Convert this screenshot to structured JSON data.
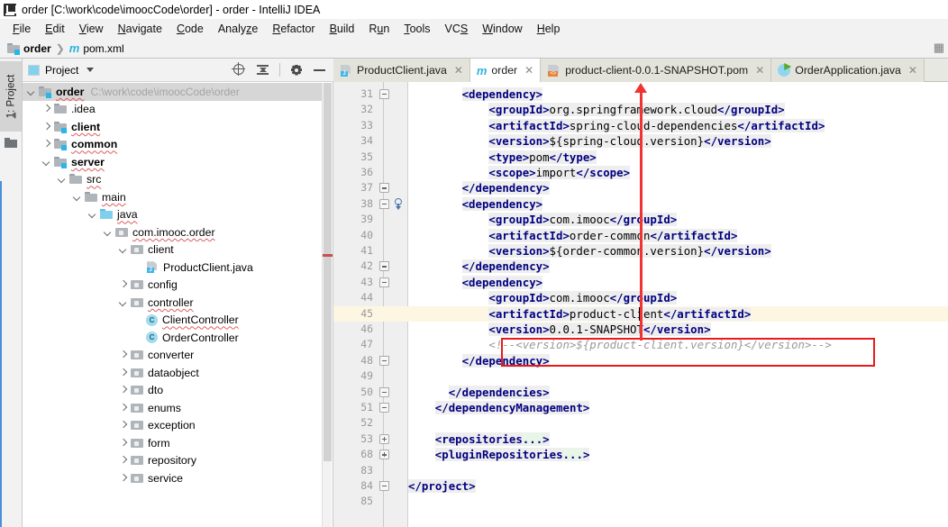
{
  "window": {
    "title": "order [C:\\work\\code\\imoocCode\\order] - order - IntelliJ IDEA",
    "logo_icon": "intellij-idea-logo"
  },
  "menubar": {
    "items": [
      {
        "label": "File",
        "mnemonic": "F"
      },
      {
        "label": "Edit",
        "mnemonic": "E"
      },
      {
        "label": "View",
        "mnemonic": "V"
      },
      {
        "label": "Navigate",
        "mnemonic": "N"
      },
      {
        "label": "Code",
        "mnemonic": "C"
      },
      {
        "label": "Analyze",
        "mnemonic": "z"
      },
      {
        "label": "Refactor",
        "mnemonic": "R"
      },
      {
        "label": "Build",
        "mnemonic": "B"
      },
      {
        "label": "Run",
        "mnemonic": "u"
      },
      {
        "label": "Tools",
        "mnemonic": "T"
      },
      {
        "label": "VCS",
        "mnemonic": "S"
      },
      {
        "label": "Window",
        "mnemonic": "W"
      },
      {
        "label": "Help",
        "mnemonic": "H"
      }
    ]
  },
  "navbar": {
    "crumbs": [
      {
        "label": "order",
        "icon": "module-folder-icon"
      },
      {
        "label": "pom.xml",
        "icon": "maven-m-icon"
      }
    ]
  },
  "left_strip": {
    "tab_label": "1: Project",
    "tab_mnemonic": "1",
    "folder_icon": "folder-icon"
  },
  "project_panel": {
    "title": "Project",
    "tools": [
      {
        "name": "locate-icon",
        "label": "Select Opened File"
      },
      {
        "name": "collapse-all-icon",
        "label": "Collapse All"
      },
      {
        "name": "gear-icon",
        "label": "Settings"
      },
      {
        "name": "minimize-icon",
        "label": "Hide"
      }
    ],
    "tree": [
      {
        "label": "order",
        "path": "C:\\work\\code\\imoocCode\\order",
        "indent": 0,
        "arrow": "down",
        "icon": "module-folder-icon",
        "bold": true,
        "selected": true,
        "squiggle": true
      },
      {
        "label": ".idea",
        "indent": 1,
        "arrow": "right",
        "icon": "folder-icon",
        "bold": false
      },
      {
        "label": "client",
        "indent": 1,
        "arrow": "right",
        "icon": "module-folder-icon",
        "bold": true,
        "squiggle": true
      },
      {
        "label": "common",
        "indent": 1,
        "arrow": "right",
        "icon": "module-folder-icon",
        "bold": true,
        "squiggle": true
      },
      {
        "label": "server",
        "indent": 1,
        "arrow": "down",
        "icon": "module-folder-icon",
        "bold": true,
        "squiggle": true
      },
      {
        "label": "src",
        "indent": 2,
        "arrow": "down",
        "icon": "folder-icon",
        "bold": false,
        "squiggle": true
      },
      {
        "label": "main",
        "indent": 3,
        "arrow": "down",
        "icon": "folder-icon",
        "bold": false,
        "squiggle": true
      },
      {
        "label": "java",
        "indent": 4,
        "arrow": "down",
        "icon": "source-folder-icon",
        "bold": false,
        "squiggle": true
      },
      {
        "label": "com.imooc.order",
        "indent": 5,
        "arrow": "down",
        "icon": "package-icon",
        "bold": false,
        "squiggle": true
      },
      {
        "label": "client",
        "indent": 6,
        "arrow": "down",
        "icon": "package-icon",
        "bold": false
      },
      {
        "label": "ProductClient.java",
        "indent": 7,
        "arrow": "none",
        "icon": "java-file-icon",
        "bold": false
      },
      {
        "label": "config",
        "indent": 6,
        "arrow": "right",
        "icon": "package-icon",
        "bold": false
      },
      {
        "label": "controller",
        "indent": 6,
        "arrow": "down",
        "icon": "package-icon",
        "bold": false,
        "squiggle": true
      },
      {
        "label": "ClientController",
        "indent": 7,
        "arrow": "none",
        "icon": "java-class-icon",
        "bold": false,
        "squiggle": true
      },
      {
        "label": "OrderController",
        "indent": 7,
        "arrow": "none",
        "icon": "java-class-icon",
        "bold": false
      },
      {
        "label": "converter",
        "indent": 6,
        "arrow": "right",
        "icon": "package-icon",
        "bold": false
      },
      {
        "label": "dataobject",
        "indent": 6,
        "arrow": "right",
        "icon": "package-icon",
        "bold": false
      },
      {
        "label": "dto",
        "indent": 6,
        "arrow": "right",
        "icon": "package-icon",
        "bold": false
      },
      {
        "label": "enums",
        "indent": 6,
        "arrow": "right",
        "icon": "package-icon",
        "bold": false
      },
      {
        "label": "exception",
        "indent": 6,
        "arrow": "right",
        "icon": "package-icon",
        "bold": false
      },
      {
        "label": "form",
        "indent": 6,
        "arrow": "right",
        "icon": "package-icon",
        "bold": false
      },
      {
        "label": "repository",
        "indent": 6,
        "arrow": "right",
        "icon": "package-icon",
        "bold": false
      },
      {
        "label": "service",
        "indent": 6,
        "arrow": "right",
        "icon": "package-icon",
        "bold": false
      }
    ]
  },
  "editor": {
    "tabs": [
      {
        "label": "ProductClient.java",
        "icon": "java-file-icon",
        "active": false,
        "closable": true
      },
      {
        "label": "order",
        "icon": "maven-m-icon",
        "active": true,
        "closable": true
      },
      {
        "label": "product-client-0.0.1-SNAPSHOT.pom",
        "icon": "xml-file-icon",
        "active": false,
        "closable": true
      },
      {
        "label": "OrderApplication.java",
        "icon": "spring-boot-icon",
        "active": false,
        "closable": true
      }
    ],
    "lines": [
      {
        "num": "31",
        "indent": 8,
        "segments": [
          {
            "text": "<dependency>",
            "style": "t"
          }
        ],
        "fold": "top"
      },
      {
        "num": "32",
        "indent": 12,
        "segments": [
          {
            "text": "<groupId>",
            "style": "t"
          },
          {
            "text": "org.springframework.cloud",
            "style": "v"
          },
          {
            "text": "</groupId>",
            "style": "t"
          }
        ]
      },
      {
        "num": "33",
        "indent": 12,
        "segments": [
          {
            "text": "<artifactId>",
            "style": "t"
          },
          {
            "text": "spring-cloud-dependencies",
            "style": "v"
          },
          {
            "text": "</artifactId>",
            "style": "t"
          }
        ]
      },
      {
        "num": "34",
        "indent": 12,
        "segments": [
          {
            "text": "<version>",
            "style": "t"
          },
          {
            "text": "${spring-cloud.version}",
            "style": "v"
          },
          {
            "text": "</version>",
            "style": "t"
          }
        ]
      },
      {
        "num": "35",
        "indent": 12,
        "segments": [
          {
            "text": "<type>",
            "style": "t"
          },
          {
            "text": "pom",
            "style": "v"
          },
          {
            "text": "</type>",
            "style": "t"
          }
        ]
      },
      {
        "num": "36",
        "indent": 12,
        "segments": [
          {
            "text": "<scope>",
            "style": "t"
          },
          {
            "text": "import",
            "style": "v"
          },
          {
            "text": "</scope>",
            "style": "t"
          }
        ]
      },
      {
        "num": "37",
        "indent": 8,
        "segments": [
          {
            "text": "</dependency>",
            "style": "t"
          }
        ],
        "fold": "bot"
      },
      {
        "num": "38",
        "indent": 8,
        "segments": [
          {
            "text": "<dependency>",
            "style": "t"
          }
        ],
        "fold": "top",
        "annotation": "dependency-download-icon"
      },
      {
        "num": "39",
        "indent": 12,
        "segments": [
          {
            "text": "<groupId>",
            "style": "t"
          },
          {
            "text": "com.imooc",
            "style": "v"
          },
          {
            "text": "</groupId>",
            "style": "t"
          }
        ]
      },
      {
        "num": "40",
        "indent": 12,
        "segments": [
          {
            "text": "<artifactId>",
            "style": "t"
          },
          {
            "text": "order-common",
            "style": "v"
          },
          {
            "text": "</artifactId>",
            "style": "t"
          }
        ]
      },
      {
        "num": "41",
        "indent": 12,
        "segments": [
          {
            "text": "<version>",
            "style": "t"
          },
          {
            "text": "${order-common.version}",
            "style": "v"
          },
          {
            "text": "</version>",
            "style": "t"
          }
        ]
      },
      {
        "num": "42",
        "indent": 8,
        "segments": [
          {
            "text": "</dependency>",
            "style": "t"
          }
        ],
        "fold": "bot"
      },
      {
        "num": "43",
        "indent": 8,
        "segments": [
          {
            "text": "<dependency>",
            "style": "t"
          }
        ],
        "fold": "top"
      },
      {
        "num": "44",
        "indent": 12,
        "segments": [
          {
            "text": "<groupId>",
            "style": "t"
          },
          {
            "text": "com.imooc",
            "style": "v"
          },
          {
            "text": "</groupId>",
            "style": "t"
          }
        ]
      },
      {
        "num": "45",
        "indent": 12,
        "segments": [
          {
            "text": "<artifactId>",
            "style": "t"
          },
          {
            "text": "product-client",
            "style": "v"
          },
          {
            "text": "</artifactId>",
            "style": "t"
          }
        ],
        "highlight": true
      },
      {
        "num": "46",
        "indent": 12,
        "segments": [
          {
            "text": "<version>",
            "style": "t"
          },
          {
            "text": "0.0.1-SNAPSHOT",
            "style": "v"
          },
          {
            "text": "</version>",
            "style": "t"
          }
        ]
      },
      {
        "num": "47",
        "indent": 12,
        "segments": [
          {
            "text": "<!--<version>${product-client.version}</version>-->",
            "style": "cmt"
          }
        ]
      },
      {
        "num": "48",
        "indent": 8,
        "segments": [
          {
            "text": "</dependency>",
            "style": "t"
          }
        ],
        "fold": "bot"
      },
      {
        "num": "49",
        "indent": 0,
        "segments": []
      },
      {
        "num": "50",
        "indent": 6,
        "segments": [
          {
            "text": "</dependencies>",
            "style": "t"
          }
        ],
        "fold": "bot"
      },
      {
        "num": "51",
        "indent": 4,
        "segments": [
          {
            "text": "</dependencyManagement>",
            "style": "t"
          }
        ],
        "fold": "bot"
      },
      {
        "num": "52",
        "indent": 0,
        "segments": []
      },
      {
        "num": "53",
        "indent": 4,
        "segments": [
          {
            "text": "<repositories",
            "style": "t"
          },
          {
            "text": "...",
            "style": "fold"
          },
          {
            "text": ">",
            "style": "t"
          }
        ],
        "fold": "plus"
      },
      {
        "num": "68",
        "indent": 4,
        "segments": [
          {
            "text": "<pluginRepositories",
            "style": "t"
          },
          {
            "text": "...",
            "style": "fold"
          },
          {
            "text": ">",
            "style": "t"
          }
        ],
        "fold": "plus"
      },
      {
        "num": "83",
        "indent": 0,
        "segments": []
      },
      {
        "num": "84",
        "indent": 0,
        "segments": [
          {
            "text": "</project>",
            "style": "t"
          }
        ],
        "fold": "bot"
      },
      {
        "num": "85",
        "indent": 0,
        "segments": []
      }
    ]
  },
  "annotations": {
    "highlight_box": {
      "color": "#e81b1b",
      "target": "version-lines-46-47"
    },
    "arrow": {
      "color": "#f03434",
      "from": "version-lines-46-47",
      "to": "tab-product-client-pom"
    }
  }
}
